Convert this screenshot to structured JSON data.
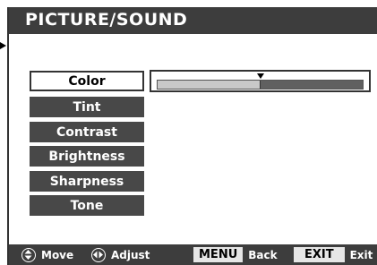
{
  "title": "PICTURE/SOUND",
  "menu": {
    "items": [
      {
        "label": "Color",
        "selected": true
      },
      {
        "label": "Tint",
        "selected": false
      },
      {
        "label": "Contrast",
        "selected": false
      },
      {
        "label": "Brightness",
        "selected": false
      },
      {
        "label": "Sharpness",
        "selected": false
      },
      {
        "label": "Tone",
        "selected": false
      }
    ]
  },
  "slider": {
    "value_fraction": 0.5
  },
  "footer": {
    "move_label": "Move",
    "adjust_label": "Adjust",
    "menu_key": "MENU",
    "back_label": "Back",
    "exit_key": "EXIT",
    "exit_label": "Exit"
  },
  "icons": {
    "move": "up-down-arrows-icon",
    "adjust": "left-right-arrows-icon"
  },
  "colors": {
    "bar": "#3d3d3d",
    "item_bg": "#484848",
    "slider_filled": "#c9c9c9",
    "slider_empty": "#606060"
  }
}
